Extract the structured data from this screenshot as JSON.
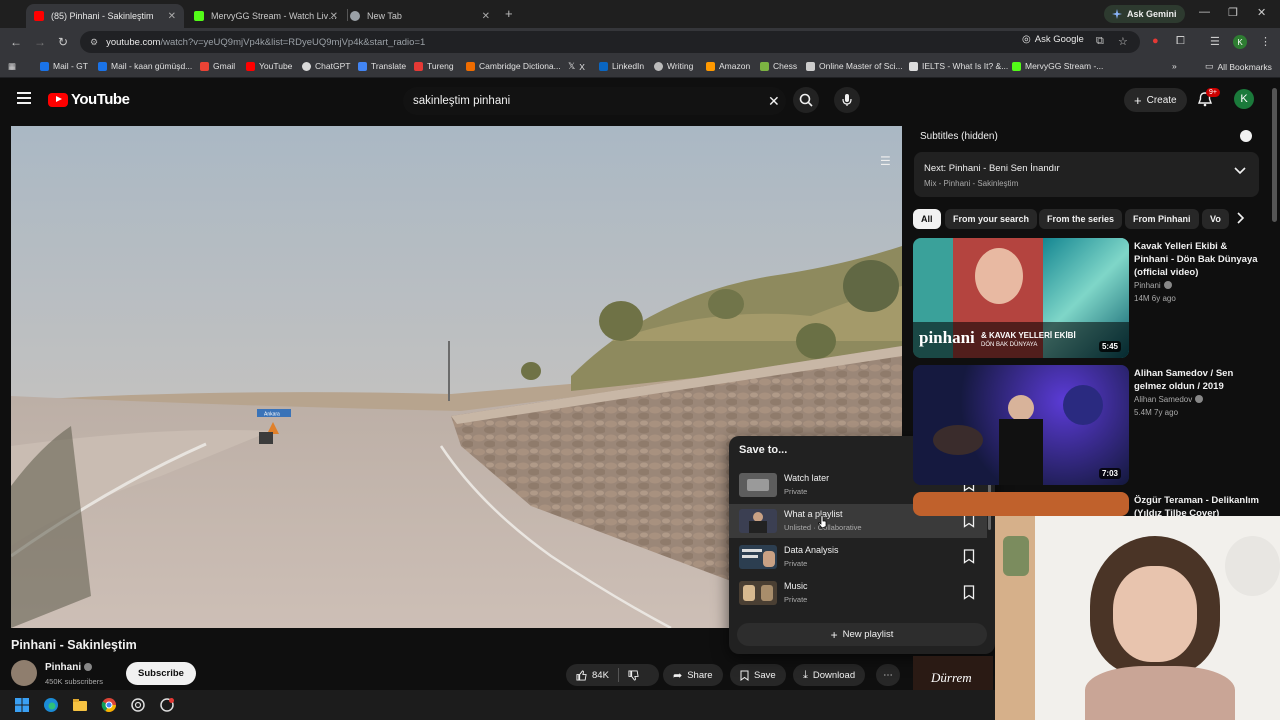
{
  "browser": {
    "tabs": [
      {
        "title": "(85) Pinhani - Sakinleştim",
        "favicon_color": "#ff0000",
        "active": true
      },
      {
        "title": "MervyGG Stream - Watch Live o",
        "favicon_color": "#53fc18",
        "active": false
      },
      {
        "title": "New Tab",
        "favicon_color": "#9aa0a6",
        "active": false
      }
    ],
    "new_tab": "+",
    "gemini_label": "Ask Gemini",
    "url_host": "youtube.com",
    "url_rest": "/watch?v=yeUQ9mjVp4k&list=RDyeUQ9mjVp4k&start_radio=1",
    "ask_google": "Ask Google",
    "profile_initial": "K",
    "bookmarks": [
      {
        "label": "Mail - GT",
        "color": "#1a73e8"
      },
      {
        "label": "Mail - kaan gümüşd...",
        "color": "#1a73e8"
      },
      {
        "label": "Gmail",
        "color": "#ea4335"
      },
      {
        "label": "YouTube",
        "color": "#ff0000"
      },
      {
        "label": "ChatGPT",
        "color": "#d9d9d9"
      },
      {
        "label": "Translate",
        "color": "#4285f4"
      },
      {
        "label": "Tureng",
        "color": "#e53935"
      },
      {
        "label": "Cambridge Dictiona...",
        "color": "#ef6c00"
      },
      {
        "label": "X",
        "color": "#ffffff"
      },
      {
        "label": "LinkedIn",
        "color": "#0a66c2"
      },
      {
        "label": "Writing",
        "color": "#bbbbbb"
      },
      {
        "label": "Amazon",
        "color": "#ff9900"
      },
      {
        "label": "Chess",
        "color": "#7cb342"
      },
      {
        "label": "Online Master of Sci...",
        "color": "#cccccc"
      },
      {
        "label": "IELTS - What Is It? &...",
        "color": "#dddddd"
      },
      {
        "label": "MervyGG Stream -...",
        "color": "#53fc18"
      }
    ],
    "all_bookmarks": "All Bookmarks"
  },
  "youtube": {
    "logo_text": "YouTube",
    "search_value": "sakinleştim pinhani",
    "create_label": "Create",
    "notif_badge": "9+",
    "avatar_initial": "K"
  },
  "video": {
    "title": "Pinhani - Sakinleştim",
    "channel": "Pinhani",
    "subscribers": "450K subscribers",
    "subscribe_label": "Subscribe",
    "likes": "84K",
    "share_label": "Share",
    "save_label": "Save",
    "download_label": "Download",
    "road_sign": "Ankara"
  },
  "save_dialog": {
    "title": "Save to...",
    "playlists": [
      {
        "name": "Watch later",
        "privacy": "Private"
      },
      {
        "name": "What a playlist",
        "privacy": "Unlisted · Collaborative"
      },
      {
        "name": "Data Analysis",
        "privacy": "Private"
      },
      {
        "name": "Music",
        "privacy": "Private"
      }
    ],
    "new_playlist": "New playlist"
  },
  "sidebar": {
    "subtitles": "Subtitles (hidden)",
    "mix_next": "Next: Pinhani - Beni Sen İnandır",
    "mix_sub": "Mix - Pinhani - Sakinleştim",
    "chips": [
      "All",
      "From your search",
      "From the series",
      "From Pinhani",
      "Vo"
    ],
    "recommendations": [
      {
        "title": "Kavak Yelleri Ekibi & Pinhani - Dön Bak Dünyaya (official video)",
        "channel": "Pinhani",
        "meta": "14M  6y ago",
        "duration": "5:45",
        "thumb_brand": "pinhani",
        "thumb_caption": "& KAVAK YELLERİ EKİBİ",
        "thumb_sub": "DÖN BAK DÜNYAYA"
      },
      {
        "title": "Alihan Samedov / Sen gelmez oldun / 2019",
        "channel": "Alihan Samedov",
        "meta": "5.4M  7y ago",
        "duration": "7:03"
      },
      {
        "title": "Özgür Teraman - Delikanlım (Yıldız Tilbe Cover)",
        "channel": "",
        "meta": "",
        "duration": ""
      }
    ],
    "bottom_thumb_text": "Dürrem"
  }
}
